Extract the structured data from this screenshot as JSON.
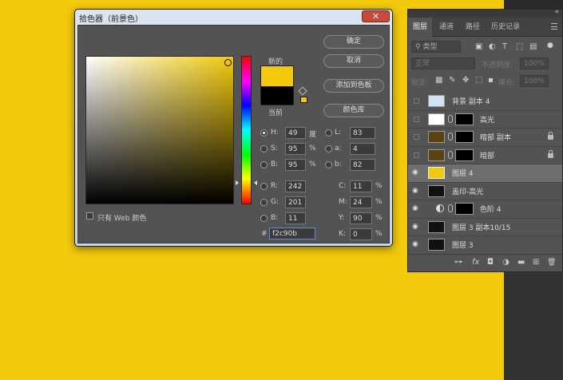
{
  "dialog": {
    "title": "拾色器（前景色）",
    "close_glyph": "✕",
    "label_new": "新的",
    "label_current": "当前",
    "buttons": {
      "ok": "确定",
      "cancel": "取消",
      "add_to_swatches": "添加到色板",
      "color_libraries": "颜色库"
    },
    "web_only_label": "只有 Web 颜色",
    "fields": {
      "H": {
        "label": "H:",
        "value": "49",
        "unit": "度"
      },
      "S": {
        "label": "S:",
        "value": "95",
        "unit": "%"
      },
      "Bv": {
        "label": "B:",
        "value": "95",
        "unit": "%"
      },
      "R": {
        "label": "R:",
        "value": "242"
      },
      "G": {
        "label": "G:",
        "value": "201"
      },
      "B": {
        "label": "B:",
        "value": "11"
      },
      "L": {
        "label": "L:",
        "value": "83"
      },
      "a": {
        "label": "a:",
        "value": "4"
      },
      "b": {
        "label": "b:",
        "value": "82"
      },
      "C": {
        "label": "C:",
        "value": "11",
        "unit": "%"
      },
      "M": {
        "label": "M:",
        "value": "24",
        "unit": "%"
      },
      "Y": {
        "label": "Y:",
        "value": "90",
        "unit": "%"
      },
      "K": {
        "label": "K:",
        "value": "0",
        "unit": "%"
      },
      "hex": {
        "label": "#",
        "value": "f2c90b"
      }
    },
    "selected_color": "#f2c90b",
    "current_color": "#000000"
  },
  "panel": {
    "collapse_glyph": "«",
    "tabs": [
      "图层",
      "通道",
      "路径",
      "历史记录"
    ],
    "filter": {
      "kind_label": "类型",
      "search_glyph": "⚲"
    },
    "blend_mode": "正常",
    "opacity_label": "不透明度:",
    "opacity_value": "100%",
    "lock_label": "锁定:",
    "fill_label": "填充:",
    "fill_value": "100%",
    "layers": [
      {
        "name": "背景 副本 4",
        "visible": false
      },
      {
        "name": "高光",
        "visible": false
      },
      {
        "name": "暗部 副本",
        "visible": false,
        "locked": true
      },
      {
        "name": "暗部",
        "visible": false,
        "locked": true
      },
      {
        "name": "图层 4",
        "visible": true,
        "selected": true
      },
      {
        "name": "盖印-高光",
        "visible": true
      },
      {
        "name": "色阶 4",
        "visible": true
      },
      {
        "name": "图层 3 副本10/15",
        "visible": true
      },
      {
        "name": "图层 3",
        "visible": true
      }
    ],
    "eye_glyph": "◉",
    "footer_icons": [
      "⊶",
      "fx",
      "◘",
      "◑",
      "▬",
      "⊞",
      "🗑"
    ]
  }
}
